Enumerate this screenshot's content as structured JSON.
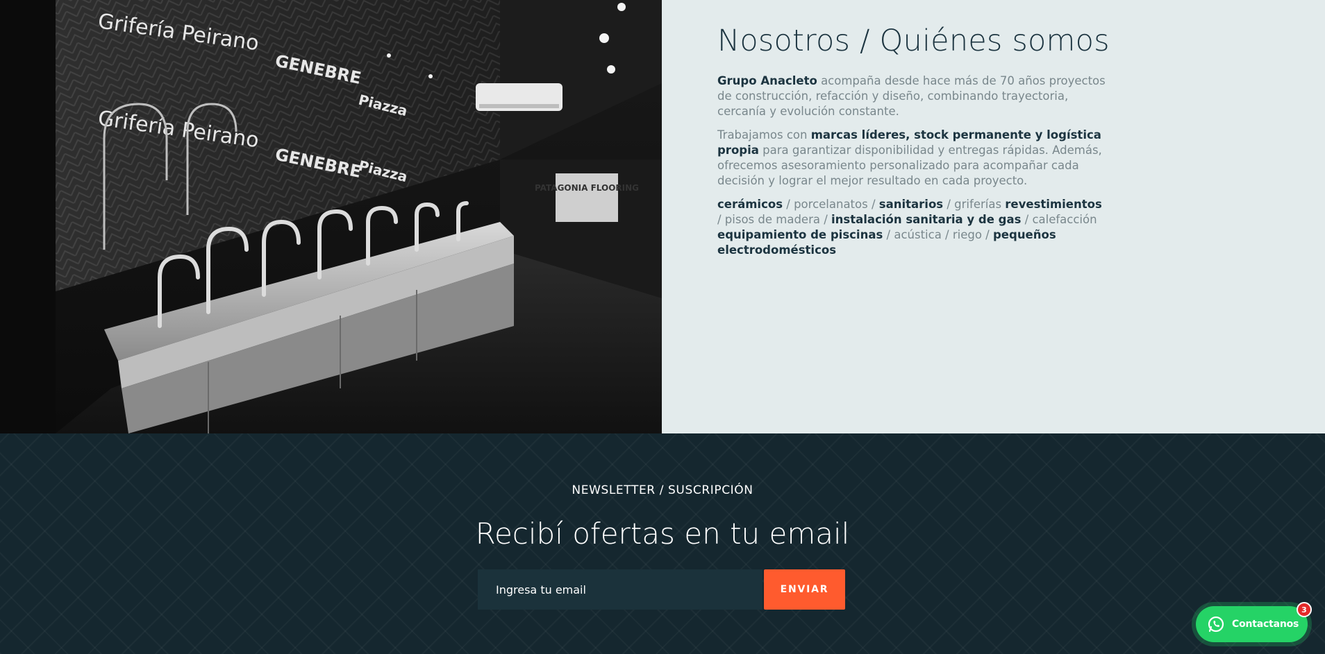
{
  "about": {
    "title": "Nosotros / Quiénes somos",
    "p1": {
      "brand": "Grupo Anacleto",
      "text": " acompaña desde hace más de 70 años proyectos de construcción, refacción y diseño, combinando trayectoria, cercanía y evolución constante."
    },
    "p2": {
      "lead": "Trabajamos con ",
      "bold": "marcas líderes, stock permanente y logística propia",
      "text": " para garantizar disponibilidad y entregas rápidas. Además, ofrecemos asesoramiento personalizado para acompañar cada decisión y lograr el mejor resultado en cada proyecto."
    },
    "categories": [
      {
        "text": "cerámicos",
        "bold": true
      },
      {
        "text": " / porcelanatos / ",
        "bold": false
      },
      {
        "text": "sanitarios",
        "bold": true
      },
      {
        "text": " / griferías ",
        "bold": false
      },
      {
        "text": "revestimientos",
        "bold": true
      },
      {
        "text": " / pisos de madera / ",
        "bold": false
      },
      {
        "text": "instalación sanitaria y de gas",
        "bold": true
      },
      {
        "text": " / calefacción ",
        "bold": false
      },
      {
        "text": "equipamiento de piscinas",
        "bold": true
      },
      {
        "text": " / acústica / riego / ",
        "bold": false
      },
      {
        "text": "pequeños electrodomésticos",
        "bold": true
      }
    ]
  },
  "photo": {
    "signs": [
      "Grifería Peirano",
      "GENEBRE",
      "Piazza",
      "Grifería Peirano",
      "GENEBRE",
      "Piazza",
      "PATAGONIA FLOORING"
    ]
  },
  "newsletter": {
    "kicker": "NEWSLETTER / SUSCRIPCIÓN",
    "title": "Recibí ofertas en tu email",
    "placeholder": "Ingresa tu email",
    "button": "ENVIAR"
  },
  "whatsapp": {
    "label": "Contactanos",
    "badge": "3",
    "icon": "whatsapp-icon"
  },
  "colors": {
    "accent": "#ff5b2e",
    "dark": "#15272f",
    "about_bg": "#e3ebec",
    "whatsapp": "#25d366"
  }
}
